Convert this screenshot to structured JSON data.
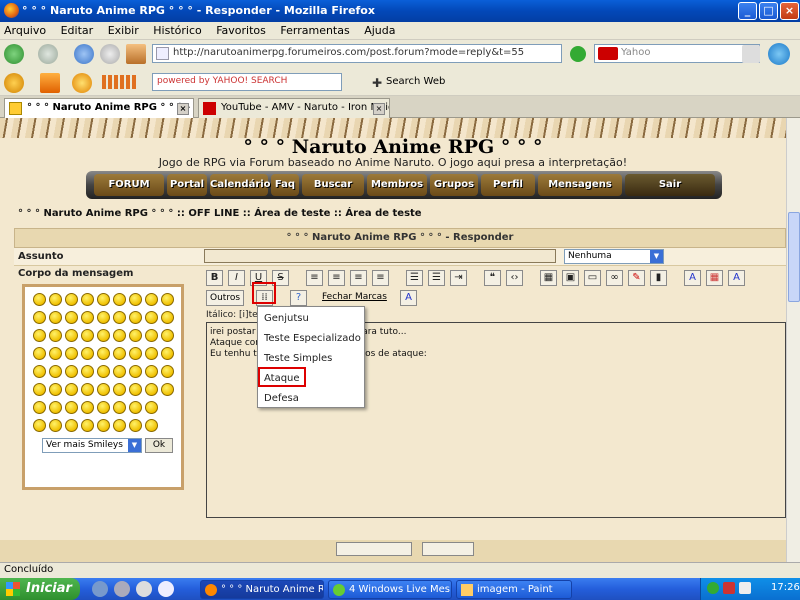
{
  "window": {
    "title": "° ° ° Naruto Anime RPG ° ° ° - Responder - Mozilla Firefox",
    "minimize": "_",
    "maximize": "□",
    "close": "×"
  },
  "menu": [
    "Arquivo",
    "Editar",
    "Exibir",
    "Histórico",
    "Favoritos",
    "Ferramentas",
    "Ajuda"
  ],
  "address": {
    "url": "http://narutoanimerpg.forumeiros.com/post.forum?mode=reply&t=55"
  },
  "search": {
    "placeholder": "Yahoo"
  },
  "yahoo_toolbar": {
    "search_placeholder": "powered by YAHOO! SEARCH",
    "search_web": "Search Web"
  },
  "tabs": [
    {
      "label": "° ° ° Naruto Anime RPG ° ° ° - Re..."
    },
    {
      "label": "YouTube - AMV - Naruto - Iron Maiden..."
    }
  ],
  "site": {
    "title": "° ° ° Naruto Anime RPG ° ° °",
    "subtitle": "Jogo de RPG via Forum baseado no Anime Naruto. O jogo aqui presa a interpretação!",
    "nav": [
      "FORUM",
      "Portal",
      "Calendário",
      "Faq",
      "Buscar",
      "Membros",
      "Grupos",
      "Perfil",
      "Mensagens",
      "Sair"
    ],
    "breadcrumb": "° ° ° Naruto Anime RPG ° ° °  :: OFF LINE :: Área de teste :: Área de teste"
  },
  "form": {
    "header": "° ° ° Naruto Anime RPG ° ° ° - Responder",
    "subject_label": "Assunto",
    "subject_select": "Nenhuma",
    "body_label": "Corpo da mensagem",
    "smiley_select": "Ver mais Smileys",
    "ok": "Ok",
    "outros": "Outros",
    "fechar_marcas": "Fechar Marcas",
    "italic_hint": "Itálico: [i]te",
    "editor_lines": [
      "irei postar                               ss para tuto...",
      "",
      "",
      "",
      "",
      "Ataque com                              a.",
      "",
      "",
      "Eu tenhu tai=5, logo jogarei 5 dados de ataque:"
    ]
  },
  "dropdown": [
    "Genjutsu",
    "Teste Especializado",
    "Teste Simples",
    "Ataque",
    "Defesa"
  ],
  "status": "Concluído",
  "taskbar": {
    "start": "Iniciar",
    "items": [
      "° ° ° Naruto Anime R...",
      "4 Windows Live Mes...",
      "imagem - Paint"
    ],
    "clock": "17:26"
  }
}
